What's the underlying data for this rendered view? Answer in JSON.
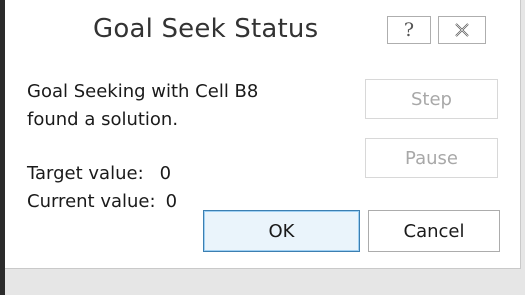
{
  "dialog": {
    "title": "Goal Seek Status",
    "help_glyph": "?",
    "close_icon": "close-icon",
    "message_line1": "Goal Seeking with Cell B8",
    "message_line2": "found a solution.",
    "target_label": "Target value:",
    "target_value": "0",
    "current_label": "Current value:",
    "current_value": "0",
    "step_label": "Step",
    "pause_label": "Pause",
    "ok_label": "OK",
    "cancel_label": "Cancel"
  },
  "colors": {
    "ok_border": "#3c7fb1",
    "ok_fill": "#eaf4fb",
    "disabled_text": "#a8a8a8"
  }
}
